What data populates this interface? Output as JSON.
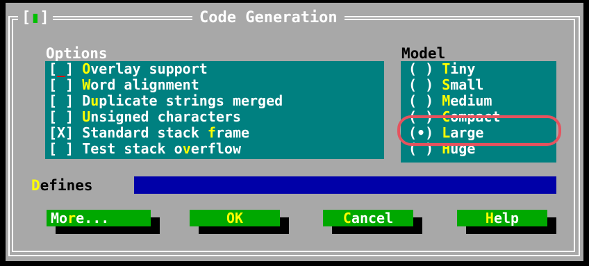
{
  "dialog": {
    "title": "Code Generation",
    "close_box": {
      "left": "[",
      "mark": "▮",
      "right": "]"
    }
  },
  "options": {
    "label": "Options",
    "items": [
      {
        "mark": "_",
        "hotkey": "O",
        "rest": "verlay support",
        "checked": false,
        "focused": true
      },
      {
        "mark": " ",
        "hotkey": "W",
        "rest": "ord alignment",
        "checked": false
      },
      {
        "mark": " ",
        "prefix": "D",
        "hotkey": "u",
        "rest": "plicate strings merged",
        "checked": false
      },
      {
        "mark": " ",
        "hotkey": "U",
        "rest": "nsigned characters",
        "checked": false
      },
      {
        "mark": "X",
        "prefix": "Standard stack ",
        "hotkey": "f",
        "rest": "rame",
        "checked": true
      },
      {
        "mark": " ",
        "prefix": "Test stack o",
        "hotkey": "v",
        "rest": "erflow",
        "checked": false
      }
    ]
  },
  "model": {
    "label": "Model",
    "items": [
      {
        "mark": " ",
        "hotkey": "T",
        "rest": "iny"
      },
      {
        "mark": " ",
        "hotkey": "S",
        "rest": "mall"
      },
      {
        "mark": " ",
        "hotkey": "M",
        "rest": "edium"
      },
      {
        "mark": " ",
        "hotkey": "C",
        "rest": "ompact"
      },
      {
        "mark": "•",
        "hotkey": "L",
        "rest": "arge",
        "selected": true
      },
      {
        "mark": " ",
        "hotkey": "H",
        "rest": "uge"
      }
    ]
  },
  "defines": {
    "hotkey": "D",
    "rest": "efines",
    "value": ""
  },
  "buttons": [
    {
      "prefix": "Mo",
      "hotkey": "r",
      "rest": "e..."
    },
    {
      "prefix": "",
      "hotkey": "",
      "rest": "OK"
    },
    {
      "prefix": "",
      "hotkey": "C",
      "rest": "ancel"
    },
    {
      "prefix": "",
      "hotkey": "H",
      "rest": "elp"
    }
  ],
  "colors": {
    "dialog_bg": "#a8a8a8",
    "panel_bg": "#008080",
    "hotkey": "#ffff00",
    "button_bg": "#00a800",
    "input_bg": "#0000a8",
    "highlight_ring": "#e5525e"
  }
}
